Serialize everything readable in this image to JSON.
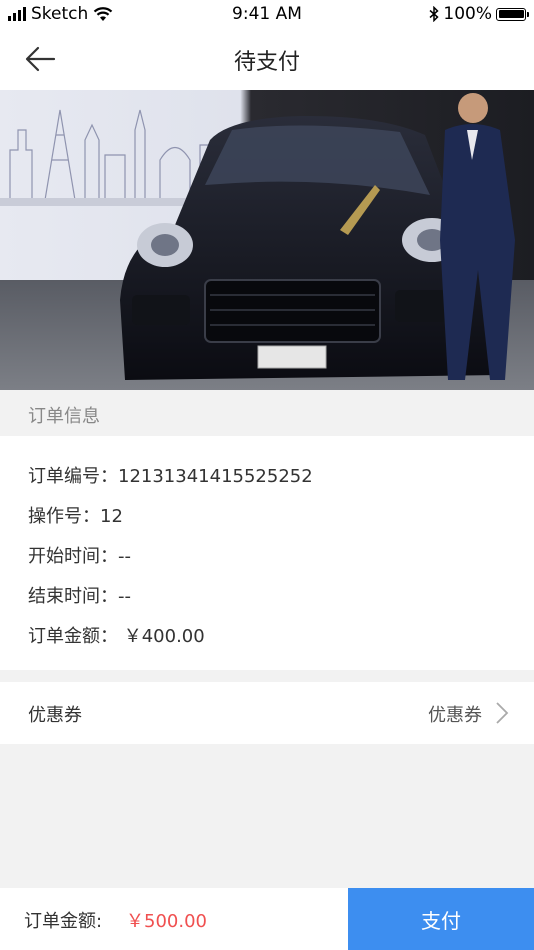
{
  "status_bar": {
    "carrier": "Sketch",
    "time": "9:41 AM",
    "battery": "100%"
  },
  "nav": {
    "title": "待支付",
    "back_icon": "arrow-left-icon"
  },
  "order_section": {
    "header": "订单信息",
    "rows": [
      {
        "label": "订单编号：",
        "value": "12131341415525252"
      },
      {
        "label": "操作号：",
        "value": "12"
      },
      {
        "label": "开始时间：",
        "value": "--"
      },
      {
        "label": "结束时间：",
        "value": "--"
      },
      {
        "label": "订单金额：",
        "value": "￥400.00"
      }
    ]
  },
  "coupon": {
    "label": "优惠券",
    "value": "优惠券",
    "icon": "chevron-right-icon"
  },
  "bottom_bar": {
    "total_label": "订单金额:",
    "total_value": "￥500.00",
    "pay_label": "支付"
  },
  "colors": {
    "accent": "#3d8ef0",
    "price": "#f05050",
    "background": "#f2f2f2"
  }
}
